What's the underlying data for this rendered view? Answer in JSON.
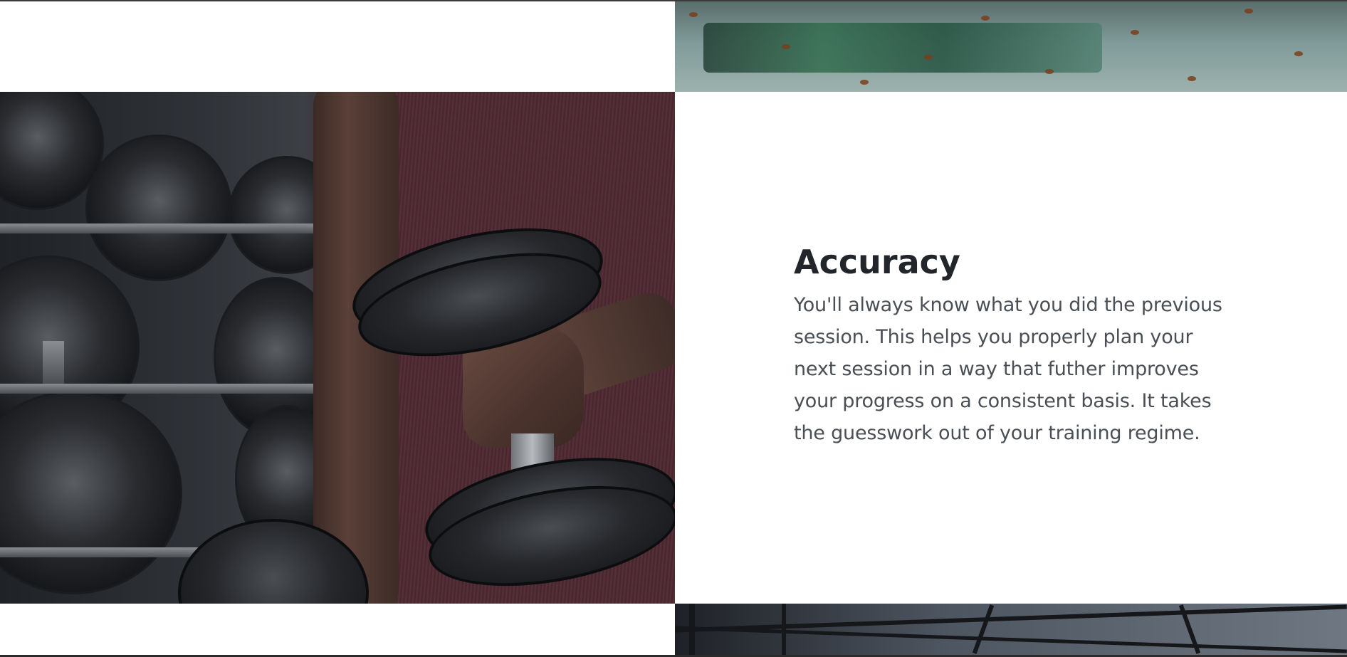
{
  "section": {
    "heading": "Accuracy",
    "body": "You'll always know what you did the previous session. This helps you properly plan your next session in a way that futher improves your progress on a consistent basis. It takes the guesswork out of your training regime."
  },
  "images": {
    "top_right": "puddle-photo",
    "left": "dumbbell-curl-photo",
    "bottom_right": "gym-rack-photo"
  },
  "colors": {
    "heading": "#22262b",
    "body": "#4a4f55",
    "background": "#ffffff"
  }
}
